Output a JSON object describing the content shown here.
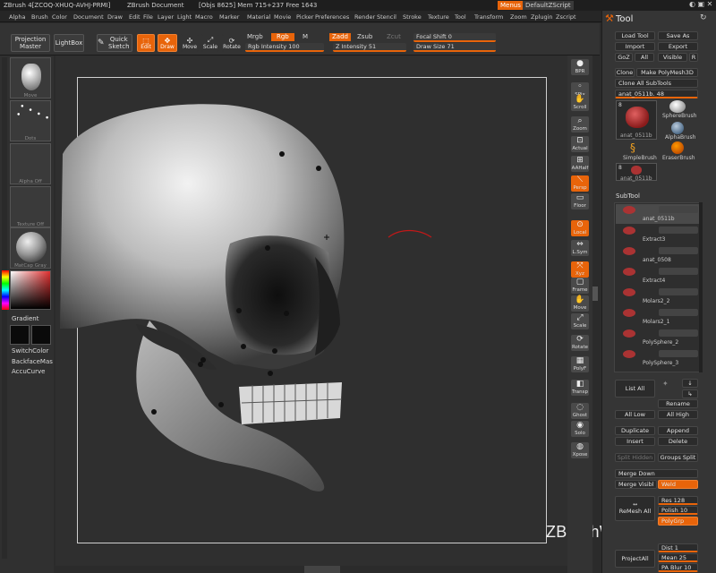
{
  "titlebar": {
    "app": "ZBrush 4[ZCOQ-XHUQ-AVHJ-PRMI]",
    "document": "ZBrush Document",
    "stats": "[Objs 8625] Mem 715+237 Free 1643",
    "menus_btn": "Menus",
    "script_btn": "DefaultZScript"
  },
  "menubar": [
    "Alpha",
    "Brush",
    "Color",
    "Document",
    "Draw",
    "Edit",
    "File",
    "Layer",
    "Light",
    "Macro",
    "Marker",
    "Material",
    "Movie",
    "Picker",
    "Preferences",
    "Render",
    "Stencil",
    "Stroke",
    "Texture",
    "Tool",
    "Transform",
    "Zoom",
    "Zplugin",
    "Zscript"
  ],
  "shelf": {
    "projection_master": "Projection Master",
    "lightbox": "LightBox",
    "quick_sketch": "Quick Sketch",
    "edit": "Edit",
    "draw": "Draw",
    "move": "Move",
    "scale": "Scale",
    "rotate": "Rotate",
    "mrgb": "Mrgb",
    "rgb": "Rgb",
    "m": "M",
    "zadd": "Zadd",
    "zsub": "Zsub",
    "zcut": "Zcut",
    "rgb_intensity_label": "Rgb Intensity",
    "rgb_intensity": "100",
    "z_intensity_label": "Z Intensity",
    "z_intensity": "51",
    "focal_shift_label": "Focal Shift",
    "focal_shift": "0",
    "draw_size_label": "Draw Size",
    "draw_size": "71"
  },
  "lefttray": {
    "brush_caption": "Move",
    "stroke_caption": "Dots",
    "alpha_caption": "Alpha Off",
    "texture_caption": "Texture Off",
    "material_caption": "MatCap Gray",
    "gradient": "Gradient",
    "switch_color": "SwitchColor",
    "backface": "BackfaceMas",
    "accucurve": "AccuCurve"
  },
  "strip": [
    "BPR",
    "SPix",
    "Scroll",
    "Zoom",
    "Actual",
    "AAHalf",
    "Persp",
    "Floor",
    "Local",
    "L.Sym",
    "Xyz",
    "Frame",
    "Move",
    "Scale",
    "Rotate",
    "PolyF",
    "Transp",
    "Ghost",
    "Solo",
    "Xpose"
  ],
  "tool": {
    "title": "Tool",
    "load_tool": "Load Tool",
    "save_as": "Save As",
    "import": "Import",
    "export": "Export",
    "goz": "GoZ",
    "all": "All",
    "visible": "Visible",
    "r": "R",
    "clone": "Clone",
    "make_polymesh": "Make PolyMesh3D",
    "clone_all": "Clone All SubTools",
    "current_tool": "anat_0511b. 48",
    "thumb_count": "8",
    "thumb_main": "anat_0511b",
    "sphere_brush": "SphereBrush",
    "alpha_brush": "AlphaBrush",
    "simple_brush": "SimpleBrush",
    "eraser_brush": "EraserBrush",
    "thumb_small": "anat_0511b",
    "subtool_title": "SubTool",
    "subtools": [
      "anat_0511b",
      "Extract3",
      "anat_0508",
      "Extract4",
      "Molars2_2",
      "Molars2_1",
      "PolySphere_2",
      "PolySphere_3"
    ],
    "list_all": "List All",
    "rename": "Rename",
    "all_low": "All Low",
    "all_high": "All High",
    "duplicate": "Duplicate",
    "append": "Append",
    "insert": "Insert",
    "delete": "Delete",
    "split_hidden": "Split Hidden",
    "groups_split": "Groups Split",
    "merge_down": "Merge Down",
    "merge_visible": "Merge Visibl",
    "weld": "Weld",
    "remesh_all": "ReMesh All",
    "res": "Res 128",
    "polish": "Polish 10",
    "polygrp": "PolyGrp",
    "project_all": "ProjectAll",
    "dist": "Dist 1",
    "mean": "Mean 25",
    "pa_blur": "PA Blur 10"
  },
  "watermark": "ZBrushWorkshops",
  "colors": {
    "accent": "#e8640a",
    "panel": "#353535",
    "canvas": "#2f2f2f"
  }
}
